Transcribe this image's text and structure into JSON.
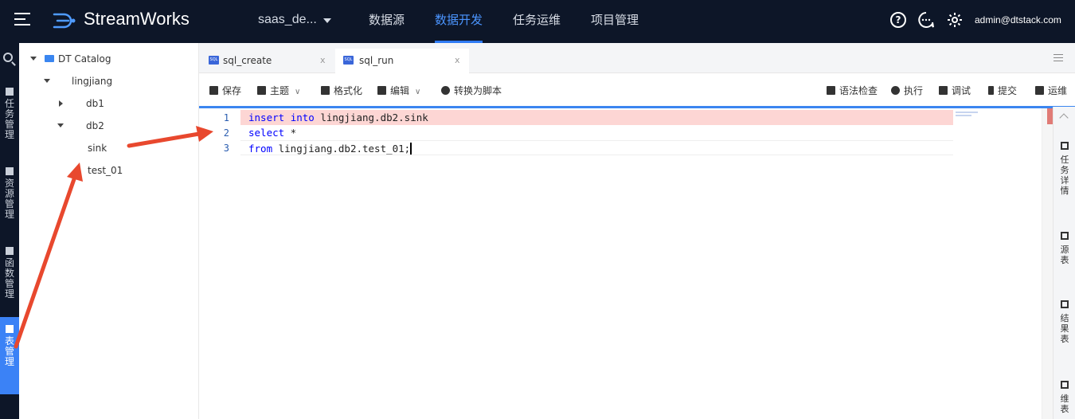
{
  "header": {
    "brand": "StreamWorks",
    "project": "saas_de...",
    "nav": [
      "数据源",
      "数据开发",
      "任务运维",
      "项目管理"
    ],
    "active_nav": "数据开发",
    "help_icon": "?",
    "user": "admin@dtstack.com",
    "accent": "#2f7bf5"
  },
  "rail": {
    "items": [
      {
        "label": [
          "任",
          "务",
          "管",
          "理"
        ],
        "icon": "task-icon"
      },
      {
        "label": [
          "资",
          "源",
          "管",
          "理"
        ],
        "icon": "resource-icon"
      },
      {
        "label": [
          "函",
          "数",
          "管",
          "理"
        ],
        "icon": "function-icon"
      },
      {
        "label": [
          "表",
          "管",
          "理"
        ],
        "icon": "table-grid-icon",
        "active": true
      }
    ]
  },
  "tree": {
    "root": "DT Catalog",
    "db": "lingjiang",
    "children": [
      "db1",
      "db2"
    ],
    "tables": [
      "sink",
      "test_01"
    ]
  },
  "tabs": [
    {
      "label": "sql_create",
      "close": "x",
      "badge": "SQL"
    },
    {
      "label": "sql_run",
      "close": "x",
      "badge": "SQL",
      "active": true
    }
  ],
  "toolbar": {
    "left": [
      "保存",
      "主题",
      "格式化",
      "编辑",
      "转换为脚本"
    ],
    "right": [
      "语法检查",
      "执行",
      "调试",
      "提交",
      "运维"
    ]
  },
  "editor": {
    "line_numbers": [
      "1",
      "2",
      "3"
    ],
    "lines": [
      [
        {
          "t": "insert",
          "k": true
        },
        {
          "t": " "
        },
        {
          "t": "into",
          "k": true
        },
        {
          "t": " lingjiang.db2.sink"
        }
      ],
      [
        {
          "t": "select",
          "k": true
        },
        {
          "t": " *"
        }
      ],
      [
        {
          "t": "from",
          "k": true
        },
        {
          "t": " lingjiang.db2.test_01;"
        }
      ]
    ],
    "error_color": "#fdd6d4"
  },
  "right_panel": {
    "items": [
      {
        "label": [
          "任",
          "务",
          "详",
          "情"
        ],
        "icon": "detail-icon"
      },
      {
        "label": [
          "源",
          "表"
        ],
        "icon": "source-table-icon"
      },
      {
        "label": [
          "结",
          "果",
          "表"
        ],
        "icon": "result-table-icon"
      },
      {
        "label": [
          "维",
          "表"
        ],
        "icon": "dimension-table-icon"
      }
    ]
  },
  "annotation_color": "#e8482e"
}
